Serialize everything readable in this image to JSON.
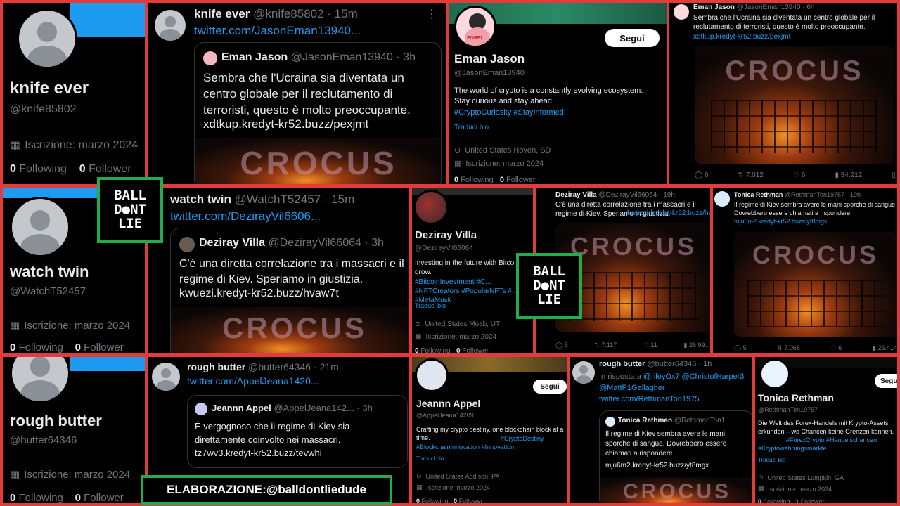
{
  "profiles": [
    {
      "name": "knife ever",
      "handle": "@knife85802",
      "joined": "Iscrizione: marzo 2024",
      "following": "0",
      "following_label": "Following",
      "followers": "0",
      "followers_label": "Follower"
    },
    {
      "name": "watch twin",
      "handle": "@WatchT52457",
      "joined": "Iscrizione: marzo 2024",
      "following": "0",
      "following_label": "Following",
      "followers": "0",
      "followers_label": "Follower"
    },
    {
      "name": "rough butter",
      "handle": "@butter64346",
      "joined": "Iscrizione: marzo 2024",
      "following": "0",
      "following_label": "Following",
      "followers": "0",
      "followers_label": "Follower"
    }
  ],
  "tweets": [
    {
      "author": "knife ever",
      "handle": "@knife85802 · 15m",
      "link": "twitter.com/JasonEman13940...",
      "quote_author": "Eman Jason",
      "quote_handle": "@JasonEman13940 · 3h",
      "quote_text": "Sembra che l'Ucraina sia diventata un centro globale per il reclutamento di terroristi, questo è molto preoccupante.",
      "quote_link": "xdtkup.kredyt-kr52.buzz/pexjmt",
      "image_text": "CROCUS"
    },
    {
      "author": "watch twin",
      "handle": "@WatchT52457 · 15m",
      "link": "twitter.com/DezirayVil6606...",
      "quote_author": "Deziray Villa",
      "quote_handle": "@DezirayVil66064 · 3h",
      "quote_text": "C'è una diretta correlazione tra i massacri e il regime di Kiev. Speriamo in giustizia.",
      "quote_link": "kwuezi.kredyt-kr52.buzz/hvaw7t",
      "image_text": "CROCUS"
    },
    {
      "author": "rough butter",
      "handle": "@butter64346 · 21m",
      "link": "twitter.com/AppelJeana1420...",
      "quote_author": "Jeannn Appel",
      "quote_handle": "@AppelJeana142... · 3h",
      "quote_text": "È vergognoso che il regime di Kiev sia direttamente coinvolto nei massacri.",
      "quote_link": "tz7wv3.kredyt-kr52.buzz/tevwhi"
    }
  ],
  "eman": {
    "name": "Eman Jason",
    "handle": "@JasonEman13940",
    "follow": "Segui",
    "bio": "The world of crypto is a constantly evolving ecosystem. Stay curious and stay ahead.",
    "tags": "#CryptoCuriosity #StayInformed",
    "translate": "Traduci bio",
    "location": "United States  Hoven, SD",
    "joined": "Iscrizione: marzo 2024",
    "following": "0",
    "following_label": "Following",
    "followers": "0",
    "followers_label": "Follower",
    "avatar_label": "FOREL"
  },
  "eman_tweet": {
    "author": "Eman Jason",
    "handle": "@JasonEman13940 · 6h",
    "text": "Sembra che l'Ucraina sia diventata un centro globale per il reclutamento di terroristi, questo è molto preoccupante.",
    "link": "xdtkup.kredyt-kr52.buzz/pexjmt",
    "image_text": "CROCUS",
    "replies": "6",
    "retweets": "7.012",
    "likes": "6",
    "views": "34.212"
  },
  "deziray": {
    "name": "Deziray Villa",
    "handle": "@DezirayVil66064",
    "bio": "Investing in the future with Bitco... it grow.",
    "tags": "#BitcoinInvestment #C... #NFTCreators #PopularNFTs #... #MetaMusk",
    "translate": "Traduci bio",
    "location": "United States  Moab, UT",
    "joined": "Iscrizione: marzo 2024",
    "following": "0",
    "following_label": "Following",
    "followers": "0",
    "followers_label": "Follower"
  },
  "deziray_tweet": {
    "author": "Deziray Villa",
    "handle": "@DezirayVil66064 · 19h",
    "text": "C'è una diretta correlazione tra i massacri e il regime di Kiev. Speriamo in giustizia.",
    "link": "kwuezi.kredyt-kr52.buzz/hv...",
    "image_text": "CROCUS",
    "replies": "5",
    "retweets": "7.117",
    "likes": "11",
    "views": "26.99..."
  },
  "tonica_tweet": {
    "author": "Tonica Rethman",
    "handle": "@RethmanTon19757 · 19h",
    "text": "Il regime di Kiev sembra avere le mani sporche di sangue. Dovrebbero essere chiamati a rispondere.",
    "link": "mju6m2.kredyt-kr52.buzz/yt8mgx",
    "image_text": "CROCUS",
    "replies": "5",
    "retweets": "7.068",
    "likes": "6",
    "views": "25.414"
  },
  "jeannn": {
    "name": "Jeannn Appel",
    "handle": "@AppelJeana14209",
    "follow": "Segui",
    "bio": "Crafting my crypto destiny, one blockchain block at a time.",
    "tags": "#CryptoDestiny #BlockchainInnovation #Innovation",
    "translate": "Traduci bio",
    "location": "United States  Addison, PA",
    "joined": "Iscrizione: marzo 2024",
    "following": "0",
    "following_label": "Following",
    "followers": "0",
    "followers_label": "Follower"
  },
  "reply_tweet": {
    "author": "rough butter",
    "handle": "@butter64346 · 1h",
    "reply_prefix": "In risposta a",
    "reply_to": "@rileyOx7 @ChristofHarper3 @MattP1Gallagher",
    "link": "twitter.com/RethmanTon1975...",
    "quote_author": "Tonica Rethman",
    "quote_handle": "@RethmanTon1...",
    "quote_text": "Il regime di Kiev sembra avere le mani sporche di sangue. Dovrebbero essere chiamati a rispondere.",
    "quote_link": "mju6m2.kredyt-kr52.buzz/yt8mgx",
    "image_text": "CROCUS"
  },
  "tonica": {
    "name": "Tonica Rethman",
    "handle": "@RethmanTon19757",
    "follow": "Segui",
    "bio": "Die Welt des Forex-Handels mit Krypto-Assets erkunden – wo Chancen keine Grenzen kennen.",
    "tags": "#ForexCrypto #Handelschancen #Kryptowährungsmärkte",
    "translate": "Traduci bio",
    "location": "United States  Lumpkin, GA",
    "joined": "Iscrizione: marzo 2024",
    "following": "0",
    "following_label": "Following",
    "followers": "1",
    "followers_label": "Follower"
  },
  "logo": {
    "line1": "BALL",
    "line2": "D●NT",
    "line3": "LIE"
  },
  "credit": "ELABORAZIONE:@balldontliedude",
  "colors": {
    "accent": "#1d9bf0",
    "frame": "#e23b3b",
    "green": "#1fae4b"
  }
}
